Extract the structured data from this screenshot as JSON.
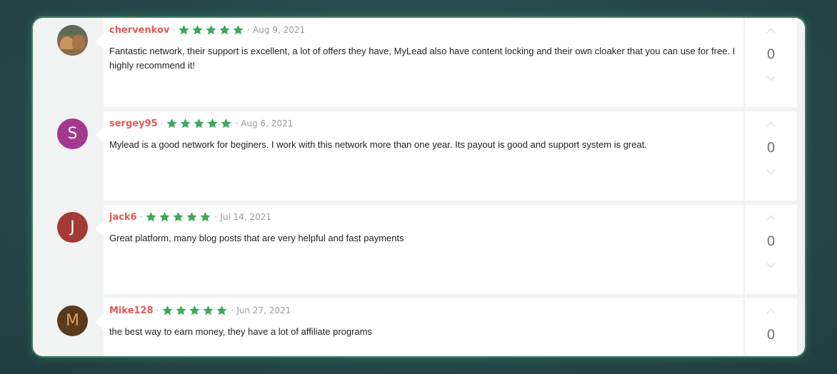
{
  "reviews": [
    {
      "username": "chervenkov",
      "rating": 5,
      "date": "Aug 9, 2021",
      "text": "Fantastic network, their support is excellent, a lot of offers they have, MyLead also have content locking and their own cloaker that you can use for free. I highly recommend it!",
      "score": "0",
      "avatar": {
        "type": "photo",
        "colors": [
          "#8b6a4a",
          "#c89a68",
          "#5a6f58"
        ]
      }
    },
    {
      "username": "sergey95",
      "rating": 5,
      "date": "Aug 6, 2021",
      "text": "Mylead is a good network for beginers. I work with this network more than one year. Its payout is good and support system is great.",
      "score": "0",
      "avatar": {
        "type": "initial",
        "letter": "S",
        "color": "#a3398f"
      }
    },
    {
      "username": "jack6",
      "rating": 5,
      "date": "Jul 14, 2021",
      "text": "Great platform, many blog posts that are very helpful and fast payments",
      "score": "0",
      "avatar": {
        "type": "initial",
        "letter": "J",
        "color": "#a23a35"
      }
    },
    {
      "username": "Mike128",
      "rating": 5,
      "date": "Jun 27, 2021",
      "text": "the best way to earn money, they have a lot of affiliate programs",
      "score": "0",
      "avatar": {
        "type": "initial",
        "letter": "M",
        "color": "#5a3a1c",
        "letter_color": "#d9a35a"
      }
    }
  ],
  "separator": "·",
  "colors": {
    "star": "#3fa85a",
    "username": "#e05a57",
    "arrow": "#e2e2e2"
  },
  "icons": {
    "star": "star-icon",
    "up": "chevron-up-icon",
    "down": "chevron-down-icon"
  }
}
